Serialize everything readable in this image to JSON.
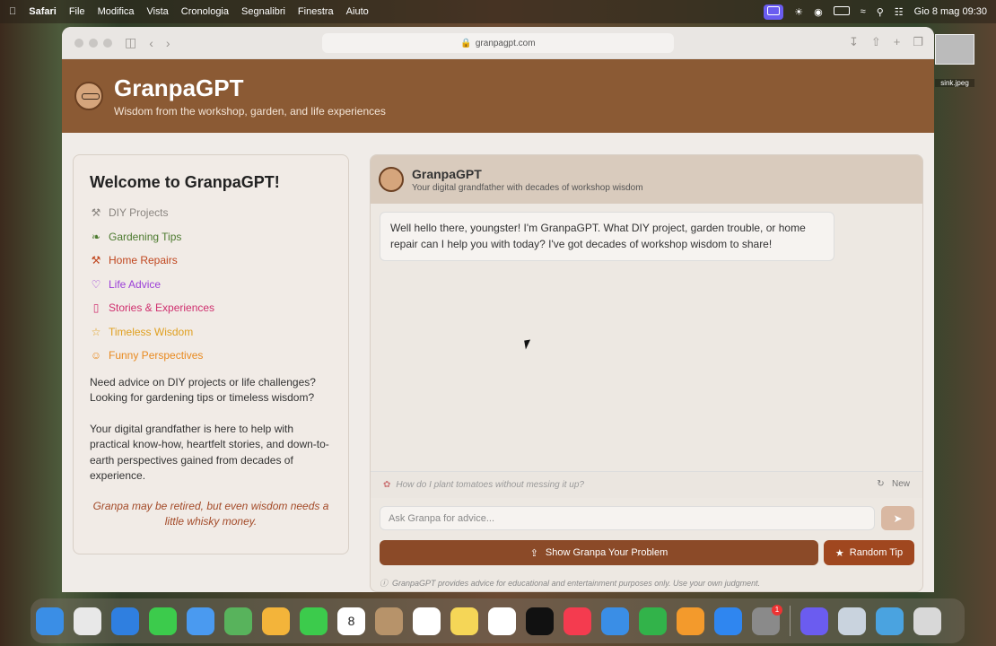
{
  "menubar": {
    "items": [
      "Safari",
      "File",
      "Modifica",
      "Vista",
      "Cronologia",
      "Segnalibri",
      "Finestra",
      "Aiuto"
    ],
    "datetime": "Gio 8 mag  09:30"
  },
  "browser": {
    "url": "granpagpt.com"
  },
  "header": {
    "title": "GranpaGPT",
    "subtitle": "Wisdom from the workshop, garden, and life experiences"
  },
  "sidebar": {
    "title": "Welcome to GranpaGPT!",
    "items": [
      {
        "label": "DIY Projects",
        "icon": "wrench-icon",
        "color": "#8a8580"
      },
      {
        "label": "Gardening Tips",
        "icon": "leaf-icon",
        "color": "#4c7a2f"
      },
      {
        "label": "Home Repairs",
        "icon": "hammer-icon",
        "color": "#c0461e"
      },
      {
        "label": "Life Advice",
        "icon": "heart-icon",
        "color": "#9b3fd8"
      },
      {
        "label": "Stories & Experiences",
        "icon": "book-icon",
        "color": "#cf2f6e"
      },
      {
        "label": "Timeless Wisdom",
        "icon": "star-icon",
        "color": "#e0a020"
      },
      {
        "label": "Funny Perspectives",
        "icon": "smile-icon",
        "color": "#e88a20"
      }
    ],
    "paragraph1": "Need advice on DIY projects or life challenges? Looking for gardening tips or timeless wisdom?",
    "paragraph2": "Your digital grandfather is here to help with practical know-how, heartfelt stories, and down-to-earth perspectives gained from decades of experience.",
    "quote": "Granpa may be retired, but even wisdom needs a little whisky money."
  },
  "chat": {
    "title": "GranpaGPT",
    "subtitle": "Your digital grandfather with decades of workshop wisdom",
    "message": "Well hello there, youngster! I'm GranpaGPT. What DIY project, garden trouble, or home repair can I help you with today? I've got decades of workshop wisdom to share!",
    "suggestion": "How do I plant tomatoes without messing it up?",
    "new_label": "New",
    "input_placeholder": "Ask Granpa for advice...",
    "problem_button": "Show Granpa Your Problem",
    "tip_button": "Random Tip",
    "disclaimer": "GranpaGPT provides advice for educational and entertainment purposes only. Use your own judgment."
  },
  "desktop": {
    "file_name": "sink.jpeg"
  },
  "dock": {
    "calendar_day": "8",
    "settings_badge": "1",
    "apps": [
      {
        "name": "finder",
        "color": "#3a8ee6"
      },
      {
        "name": "launchpad",
        "color": "#e8e8e8"
      },
      {
        "name": "safari",
        "color": "#2f7fe0"
      },
      {
        "name": "messages",
        "color": "#3ccb4c"
      },
      {
        "name": "mail",
        "color": "#4a9af0"
      },
      {
        "name": "maps",
        "color": "#58b35c"
      },
      {
        "name": "photos",
        "color": "#f3b43a"
      },
      {
        "name": "facetime",
        "color": "#3ccb4c"
      },
      {
        "name": "calendar",
        "color": "#ffffff"
      },
      {
        "name": "contacts",
        "color": "#b7936a"
      },
      {
        "name": "reminders",
        "color": "#ffffff"
      },
      {
        "name": "notes",
        "color": "#f5d657"
      },
      {
        "name": "freeform",
        "color": "#ffffff"
      },
      {
        "name": "tv",
        "color": "#111111"
      },
      {
        "name": "music",
        "color": "#f43b4f"
      },
      {
        "name": "keynote",
        "color": "#3a8ee6"
      },
      {
        "name": "numbers",
        "color": "#32b34a"
      },
      {
        "name": "pages",
        "color": "#f39a2c"
      },
      {
        "name": "app-store",
        "color": "#2f86f0"
      },
      {
        "name": "system-settings",
        "color": "#8a8a8a"
      }
    ],
    "apps_right": [
      {
        "name": "perplexity",
        "color": "#6b5cf0"
      },
      {
        "name": "preview",
        "color": "#c9d3de"
      },
      {
        "name": "downloads-folder",
        "color": "#4aa3e0"
      },
      {
        "name": "trash",
        "color": "#d8d8d8"
      }
    ]
  }
}
